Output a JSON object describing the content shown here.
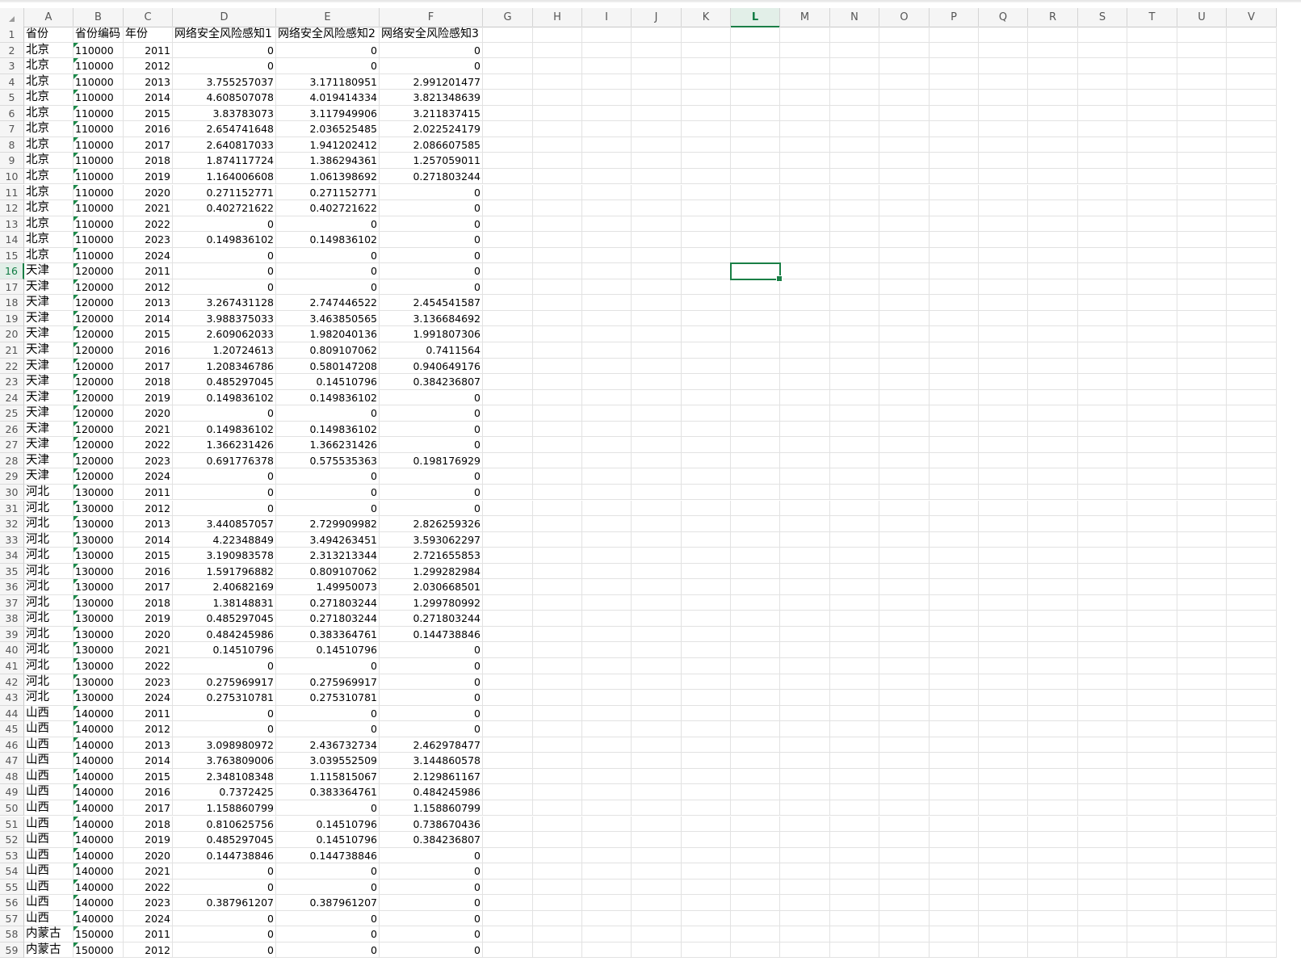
{
  "grid": {
    "columns": [
      "A",
      "B",
      "C",
      "D",
      "E",
      "F",
      "G",
      "H",
      "I",
      "J",
      "K",
      "L",
      "M",
      "N",
      "O",
      "P",
      "Q",
      "R",
      "S",
      "T",
      "U",
      "V"
    ],
    "selected_cell": {
      "column": "L",
      "row": 16
    },
    "colors": {
      "selection": "#1a7f46",
      "header_bg": "#f5f5f5",
      "gridline": "#e2e2e2",
      "text_flag": "#1b8a4a"
    }
  },
  "sheet": {
    "header_row": [
      "省份",
      "省份编码",
      "年份",
      "网络安全风险感知1",
      "网络安全风险感知2",
      "网络安全风险感知3"
    ],
    "rows": [
      [
        "北京",
        "110000",
        "2011",
        "0",
        "0",
        "0"
      ],
      [
        "北京",
        "110000",
        "2012",
        "0",
        "0",
        "0"
      ],
      [
        "北京",
        "110000",
        "2013",
        "3.755257037",
        "3.171180951",
        "2.991201477"
      ],
      [
        "北京",
        "110000",
        "2014",
        "4.608507078",
        "4.019414334",
        "3.821348639"
      ],
      [
        "北京",
        "110000",
        "2015",
        "3.83783073",
        "3.117949906",
        "3.211837415"
      ],
      [
        "北京",
        "110000",
        "2016",
        "2.654741648",
        "2.036525485",
        "2.022524179"
      ],
      [
        "北京",
        "110000",
        "2017",
        "2.640817033",
        "1.941202412",
        "2.086607585"
      ],
      [
        "北京",
        "110000",
        "2018",
        "1.874117724",
        "1.386294361",
        "1.257059011"
      ],
      [
        "北京",
        "110000",
        "2019",
        "1.164006608",
        "1.061398692",
        "0.271803244"
      ],
      [
        "北京",
        "110000",
        "2020",
        "0.271152771",
        "0.271152771",
        "0"
      ],
      [
        "北京",
        "110000",
        "2021",
        "0.402721622",
        "0.402721622",
        "0"
      ],
      [
        "北京",
        "110000",
        "2022",
        "0",
        "0",
        "0"
      ],
      [
        "北京",
        "110000",
        "2023",
        "0.149836102",
        "0.149836102",
        "0"
      ],
      [
        "北京",
        "110000",
        "2024",
        "0",
        "0",
        "0"
      ],
      [
        "天津",
        "120000",
        "2011",
        "0",
        "0",
        "0"
      ],
      [
        "天津",
        "120000",
        "2012",
        "0",
        "0",
        "0"
      ],
      [
        "天津",
        "120000",
        "2013",
        "3.267431128",
        "2.747446522",
        "2.454541587"
      ],
      [
        "天津",
        "120000",
        "2014",
        "3.988375033",
        "3.463850565",
        "3.136684692"
      ],
      [
        "天津",
        "120000",
        "2015",
        "2.609062033",
        "1.982040136",
        "1.991807306"
      ],
      [
        "天津",
        "120000",
        "2016",
        "1.20724613",
        "0.809107062",
        "0.7411564"
      ],
      [
        "天津",
        "120000",
        "2017",
        "1.208346786",
        "0.580147208",
        "0.940649176"
      ],
      [
        "天津",
        "120000",
        "2018",
        "0.485297045",
        "0.14510796",
        "0.384236807"
      ],
      [
        "天津",
        "120000",
        "2019",
        "0.149836102",
        "0.149836102",
        "0"
      ],
      [
        "天津",
        "120000",
        "2020",
        "0",
        "0",
        "0"
      ],
      [
        "天津",
        "120000",
        "2021",
        "0.149836102",
        "0.149836102",
        "0"
      ],
      [
        "天津",
        "120000",
        "2022",
        "1.366231426",
        "1.366231426",
        "0"
      ],
      [
        "天津",
        "120000",
        "2023",
        "0.691776378",
        "0.575535363",
        "0.198176929"
      ],
      [
        "天津",
        "120000",
        "2024",
        "0",
        "0",
        "0"
      ],
      [
        "河北",
        "130000",
        "2011",
        "0",
        "0",
        "0"
      ],
      [
        "河北",
        "130000",
        "2012",
        "0",
        "0",
        "0"
      ],
      [
        "河北",
        "130000",
        "2013",
        "3.440857057",
        "2.729909982",
        "2.826259326"
      ],
      [
        "河北",
        "130000",
        "2014",
        "4.22348849",
        "3.494263451",
        "3.593062297"
      ],
      [
        "河北",
        "130000",
        "2015",
        "3.190983578",
        "2.313213344",
        "2.721655853"
      ],
      [
        "河北",
        "130000",
        "2016",
        "1.591796882",
        "0.809107062",
        "1.299282984"
      ],
      [
        "河北",
        "130000",
        "2017",
        "2.40682169",
        "1.49950073",
        "2.030668501"
      ],
      [
        "河北",
        "130000",
        "2018",
        "1.38148831",
        "0.271803244",
        "1.299780992"
      ],
      [
        "河北",
        "130000",
        "2019",
        "0.485297045",
        "0.271803244",
        "0.271803244"
      ],
      [
        "河北",
        "130000",
        "2020",
        "0.484245986",
        "0.383364761",
        "0.144738846"
      ],
      [
        "河北",
        "130000",
        "2021",
        "0.14510796",
        "0.14510796",
        "0"
      ],
      [
        "河北",
        "130000",
        "2022",
        "0",
        "0",
        "0"
      ],
      [
        "河北",
        "130000",
        "2023",
        "0.275969917",
        "0.275969917",
        "0"
      ],
      [
        "河北",
        "130000",
        "2024",
        "0.275310781",
        "0.275310781",
        "0"
      ],
      [
        "山西",
        "140000",
        "2011",
        "0",
        "0",
        "0"
      ],
      [
        "山西",
        "140000",
        "2012",
        "0",
        "0",
        "0"
      ],
      [
        "山西",
        "140000",
        "2013",
        "3.098980972",
        "2.436732734",
        "2.462978477"
      ],
      [
        "山西",
        "140000",
        "2014",
        "3.763809006",
        "3.039552509",
        "3.144860578"
      ],
      [
        "山西",
        "140000",
        "2015",
        "2.348108348",
        "1.115815067",
        "2.129861167"
      ],
      [
        "山西",
        "140000",
        "2016",
        "0.7372425",
        "0.383364761",
        "0.484245986"
      ],
      [
        "山西",
        "140000",
        "2017",
        "1.158860799",
        "0",
        "1.158860799"
      ],
      [
        "山西",
        "140000",
        "2018",
        "0.810625756",
        "0.14510796",
        "0.738670436"
      ],
      [
        "山西",
        "140000",
        "2019",
        "0.485297045",
        "0.14510796",
        "0.384236807"
      ],
      [
        "山西",
        "140000",
        "2020",
        "0.144738846",
        "0.144738846",
        "0"
      ],
      [
        "山西",
        "140000",
        "2021",
        "0",
        "0",
        "0"
      ],
      [
        "山西",
        "140000",
        "2022",
        "0",
        "0",
        "0"
      ],
      [
        "山西",
        "140000",
        "2023",
        "0.387961207",
        "0.387961207",
        "0"
      ],
      [
        "山西",
        "140000",
        "2024",
        "0",
        "0",
        "0"
      ],
      [
        "内蒙古",
        "150000",
        "2011",
        "0",
        "0",
        "0"
      ],
      [
        "内蒙古",
        "150000",
        "2012",
        "0",
        "0",
        "0"
      ]
    ]
  }
}
